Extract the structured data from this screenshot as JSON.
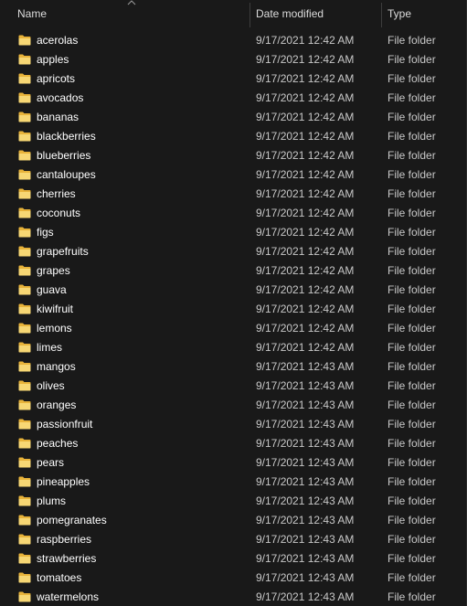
{
  "columns": {
    "name": "Name",
    "date_modified": "Date modified",
    "type": "Type",
    "sort": "ascending"
  },
  "icons": {
    "folder": "folder-icon",
    "sort": "chevron-up-icon",
    "folder_color": "#e8b33a",
    "folder_light": "#f7d774"
  },
  "rows": [
    {
      "name": "acerolas",
      "date": "9/17/2021 12:42 AM",
      "type": "File folder"
    },
    {
      "name": "apples",
      "date": "9/17/2021 12:42 AM",
      "type": "File folder"
    },
    {
      "name": "apricots",
      "date": "9/17/2021 12:42 AM",
      "type": "File folder"
    },
    {
      "name": "avocados",
      "date": "9/17/2021 12:42 AM",
      "type": "File folder"
    },
    {
      "name": "bananas",
      "date": "9/17/2021 12:42 AM",
      "type": "File folder"
    },
    {
      "name": "blackberries",
      "date": "9/17/2021 12:42 AM",
      "type": "File folder"
    },
    {
      "name": "blueberries",
      "date": "9/17/2021 12:42 AM",
      "type": "File folder"
    },
    {
      "name": "cantaloupes",
      "date": "9/17/2021 12:42 AM",
      "type": "File folder"
    },
    {
      "name": "cherries",
      "date": "9/17/2021 12:42 AM",
      "type": "File folder"
    },
    {
      "name": "coconuts",
      "date": "9/17/2021 12:42 AM",
      "type": "File folder"
    },
    {
      "name": "figs",
      "date": "9/17/2021 12:42 AM",
      "type": "File folder"
    },
    {
      "name": "grapefruits",
      "date": "9/17/2021 12:42 AM",
      "type": "File folder"
    },
    {
      "name": "grapes",
      "date": "9/17/2021 12:42 AM",
      "type": "File folder"
    },
    {
      "name": "guava",
      "date": "9/17/2021 12:42 AM",
      "type": "File folder"
    },
    {
      "name": "kiwifruit",
      "date": "9/17/2021 12:42 AM",
      "type": "File folder"
    },
    {
      "name": "lemons",
      "date": "9/17/2021 12:42 AM",
      "type": "File folder"
    },
    {
      "name": "limes",
      "date": "9/17/2021 12:42 AM",
      "type": "File folder"
    },
    {
      "name": "mangos",
      "date": "9/17/2021 12:43 AM",
      "type": "File folder"
    },
    {
      "name": "olives",
      "date": "9/17/2021 12:43 AM",
      "type": "File folder"
    },
    {
      "name": "oranges",
      "date": "9/17/2021 12:43 AM",
      "type": "File folder"
    },
    {
      "name": "passionfruit",
      "date": "9/17/2021 12:43 AM",
      "type": "File folder"
    },
    {
      "name": "peaches",
      "date": "9/17/2021 12:43 AM",
      "type": "File folder"
    },
    {
      "name": "pears",
      "date": "9/17/2021 12:43 AM",
      "type": "File folder"
    },
    {
      "name": "pineapples",
      "date": "9/17/2021 12:43 AM",
      "type": "File folder"
    },
    {
      "name": "plums",
      "date": "9/17/2021 12:43 AM",
      "type": "File folder"
    },
    {
      "name": "pomegranates",
      "date": "9/17/2021 12:43 AM",
      "type": "File folder"
    },
    {
      "name": "raspberries",
      "date": "9/17/2021 12:43 AM",
      "type": "File folder"
    },
    {
      "name": "strawberries",
      "date": "9/17/2021 12:43 AM",
      "type": "File folder"
    },
    {
      "name": "tomatoes",
      "date": "9/17/2021 12:43 AM",
      "type": "File folder"
    },
    {
      "name": "watermelons",
      "date": "9/17/2021 12:43 AM",
      "type": "File folder"
    }
  ]
}
